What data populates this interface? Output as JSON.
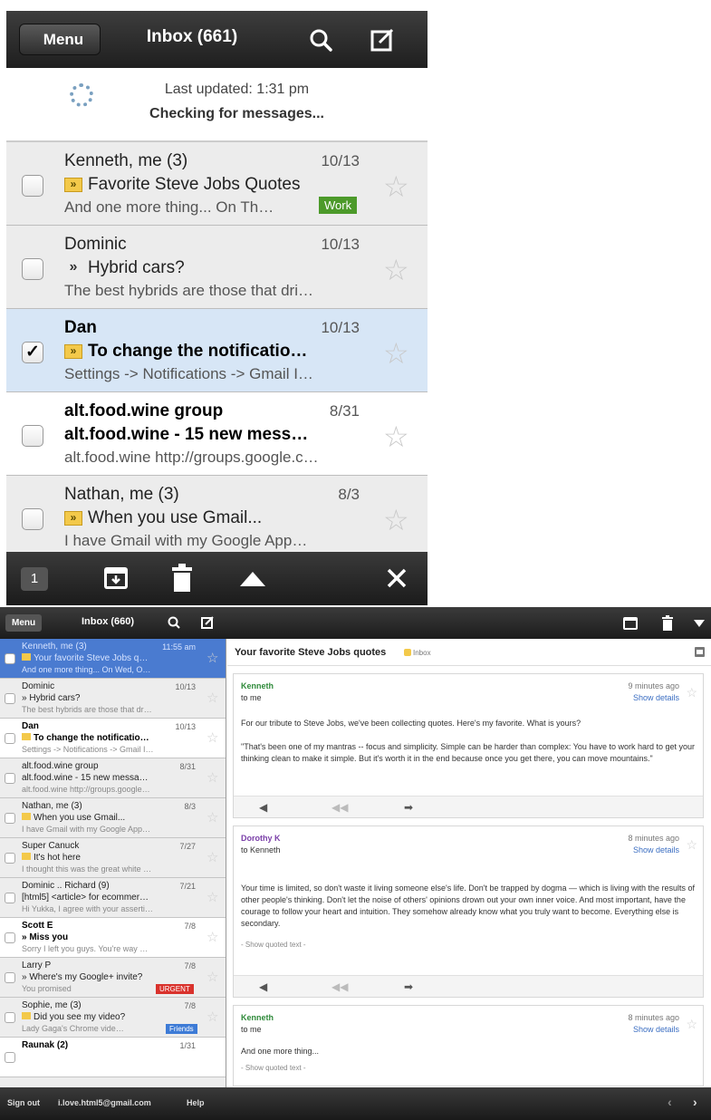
{
  "phone": {
    "header": {
      "menu_label": "Menu",
      "title": "Inbox (661)"
    },
    "status": {
      "last_updated": "Last updated: 1:31 pm",
      "checking": "Checking for messages..."
    },
    "rows": [
      {
        "sender": "Kenneth, me (3)",
        "date": "10/13",
        "subject": "Favorite Steve Jobs Quotes",
        "snippet": "And one more thing... On Th…",
        "label": "Work"
      },
      {
        "sender": "Dominic",
        "date": "10/13",
        "subject": "Hybrid cars?",
        "snippet": "The best hybrids are those that dri…"
      },
      {
        "sender": "Dan",
        "date": "10/13",
        "subject": "To change the notificatio…",
        "snippet": "Settings -> Notifications -> Gmail I…"
      },
      {
        "sender": "alt.food.wine group",
        "date": "8/31",
        "subject": "alt.food.wine - 15 new mess…",
        "snippet": "alt.food.wine http://groups.google.c…"
      },
      {
        "sender": "Nathan, me (3)",
        "date": "8/3",
        "subject": "When you use Gmail...",
        "snippet": "I have Gmail with my Google App…"
      }
    ],
    "toolbar": {
      "selected_count": "1"
    }
  },
  "tablet": {
    "topbar": {
      "menu_label": "Menu",
      "title": "Inbox (660)"
    },
    "rows": [
      {
        "sender": "Kenneth, me (3)",
        "date": "11:55 am",
        "subject": "Your favorite Steve Jobs q…",
        "snippet": "And one more thing... On Wed, O…"
      },
      {
        "sender": "Dominic",
        "date": "10/13",
        "subject": "Hybrid cars?",
        "snippet": "The best hybrids are those that dr…"
      },
      {
        "sender": "Dan",
        "date": "10/13",
        "subject": "To change the notificatio…",
        "snippet": "Settings -> Notifications -> Gmail I…"
      },
      {
        "sender": "alt.food.wine group",
        "date": "8/31",
        "subject": "alt.food.wine - 15 new messa…",
        "snippet": "alt.food.wine http://groups.google…"
      },
      {
        "sender": "Nathan, me (3)",
        "date": "8/3",
        "subject": "When you use Gmail...",
        "snippet": "I have Gmail with my Google App…"
      },
      {
        "sender": "Super Canuck",
        "date": "7/27",
        "subject": "It's hot here",
        "snippet": "I thought this was the great white …"
      },
      {
        "sender": "Dominic .. Richard (9)",
        "date": "7/21",
        "subject": "[html5] <article> for ecommer…",
        "snippet": "Hi Yukka, I agree with your asserti…"
      },
      {
        "sender": "Scott E",
        "date": "7/8",
        "subject": "Miss you",
        "snippet": "Sorry I left you guys. You're way …"
      },
      {
        "sender": "Larry P",
        "date": "7/8",
        "subject": "Where's my Google+ invite?",
        "snippet": "You promised",
        "label": "URGENT"
      },
      {
        "sender": "Sophie, me (3)",
        "date": "7/8",
        "subject": "Did you see my video?",
        "snippet": "Lady Gaga's Chrome vide…",
        "label": "Friends"
      },
      {
        "sender": "Raunak (2)",
        "date": "1/31",
        "subject": "",
        "snippet": ""
      }
    ],
    "thread": {
      "subject": "Your favorite Steve Jobs quotes",
      "inbox_tag": "Inbox",
      "messages": [
        {
          "from": "Kenneth",
          "to": "to me",
          "time": "9 minutes ago",
          "details": "Show details",
          "body_1": "For our tribute to Steve Jobs, we've been collecting quotes. Here's my favorite. What is yours?",
          "body_2": "\"That's been one of my mantras -- focus and simplicity. Simple can be harder than complex: You have to work hard to get your thinking clean to make it simple. But it's worth it in the end because once you get there, you can move mountains.\""
        },
        {
          "from": "Dorothy K",
          "to": "to Kenneth",
          "time": "8 minutes ago",
          "details": "Show details",
          "body_1": "Your time is limited, so don't waste it living someone else's life. Don't be trapped by dogma — which is living with the results of other people's thinking. Don't let the noise of others' opinions drown out your own inner voice. And most important, have the courage to follow your heart and intuition. They somehow already know what you truly want to become. Everything else is secondary.",
          "quoted": "- Show quoted text -"
        },
        {
          "from": "Kenneth",
          "to": "to me",
          "time": "8 minutes ago",
          "details": "Show details",
          "body_1": "And one more thing...",
          "quoted": "- Show quoted text -"
        }
      ]
    },
    "bottombar": {
      "sign_out": "Sign out",
      "email": "i.love.html5@gmail.com",
      "help": "Help"
    }
  },
  "colors": {
    "work_label": "#4c9a2a",
    "urgent_label": "#d9322c",
    "friends_label": "#3d7bd6",
    "selected_row": "#d7e6f6",
    "sender_green": "#2f8a3a",
    "sender_purple": "#7a3fa8"
  }
}
